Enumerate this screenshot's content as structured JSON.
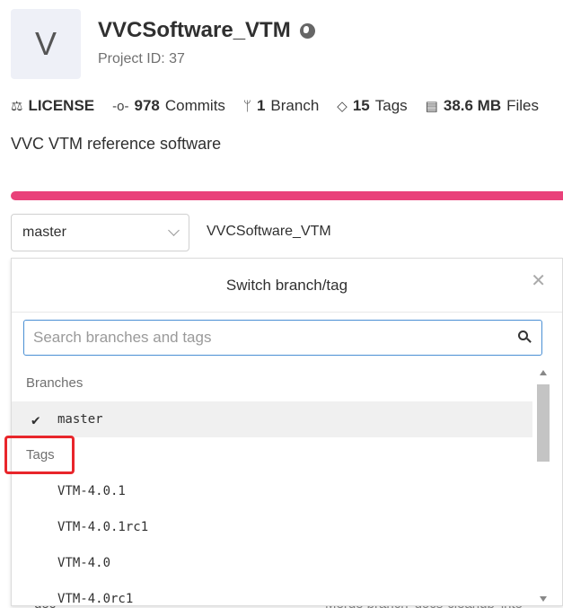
{
  "project": {
    "avatar_letter": "V",
    "title": "VVCSoftware_VTM",
    "visibility_icon": "globe-icon",
    "project_id": "Project ID: 37",
    "description": "VVC VTM reference software"
  },
  "stats": {
    "license": {
      "icon": "scale-icon",
      "label": "LICENSE"
    },
    "commits": {
      "icon": "commit-icon",
      "count": "978",
      "label": "Commits"
    },
    "branches": {
      "icon": "branch-icon",
      "count": "1",
      "label": "Branch"
    },
    "tags": {
      "icon": "tag-icon",
      "count": "15",
      "label": "Tags"
    },
    "files": {
      "icon": "file-icon",
      "count": "38.6 MB",
      "label": "Files"
    }
  },
  "colors": {
    "accent_bar": "#e9417a",
    "search_border": "#4a8fd4",
    "highlight": "#e8262b"
  },
  "toolbar": {
    "branch_selected": "master",
    "path": "VVCSoftware_VTM"
  },
  "dropdown": {
    "title": "Switch branch/tag",
    "close_icon": "close-icon",
    "search_placeholder": "Search branches and tags",
    "branches_header": "Branches",
    "branches": [
      {
        "name": "master",
        "selected": true
      }
    ],
    "tags_header": "Tags",
    "tags": [
      "VTM-4.0.1",
      "VTM-4.0.1rc1",
      "VTM-4.0",
      "VTM-4.0rc1"
    ]
  },
  "background_peek": {
    "left": "doc",
    "right": "Merge branch 'docs-cleanup' into"
  }
}
